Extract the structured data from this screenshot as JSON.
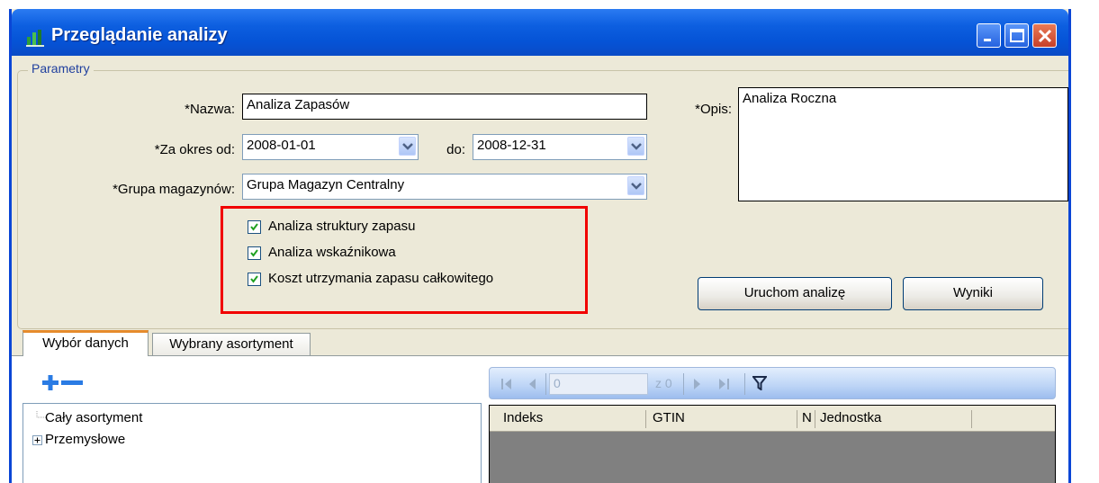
{
  "window": {
    "title": "Przeglądanie analizy",
    "controls": [
      "minimize",
      "maximize",
      "close"
    ]
  },
  "params": {
    "group_label": "Parametry",
    "name_label": "*Nazwa:",
    "name_value": "Analiza Zapasów",
    "period_label": "*Za okres od:",
    "date_from": "2008-01-01",
    "to_label": "do:",
    "date_to": "2008-12-31",
    "group_label_mag": "*Grupa magazynów:",
    "group_value": "Grupa Magazyn Centralny",
    "desc_label": "*Opis:",
    "desc_value": "Analiza Roczna",
    "checkboxes": [
      {
        "label": "Analiza struktury zapasu",
        "checked": true
      },
      {
        "label": "Analiza wskaźnikowa",
        "checked": true
      },
      {
        "label": "Koszt utrzymania zapasu całkowitego",
        "checked": true
      }
    ],
    "run_button": "Uruchom analizę",
    "results_button": "Wyniki"
  },
  "tabs": [
    {
      "label": "Wybór danych",
      "active": true
    },
    {
      "label": "Wybrany asortyment",
      "active": false
    }
  ],
  "tree": {
    "items": [
      "Cały asortyment",
      "Przemysłowe"
    ]
  },
  "navigator": {
    "position_value": "0",
    "of_text": "z 0"
  },
  "grid": {
    "columns": [
      "Indeks",
      "GTIN",
      "N",
      "Jednostka"
    ]
  },
  "colors": {
    "titlebar": "#0553D6",
    "highlight_box": "#F10000",
    "window_bg": "#ECE9D8"
  }
}
